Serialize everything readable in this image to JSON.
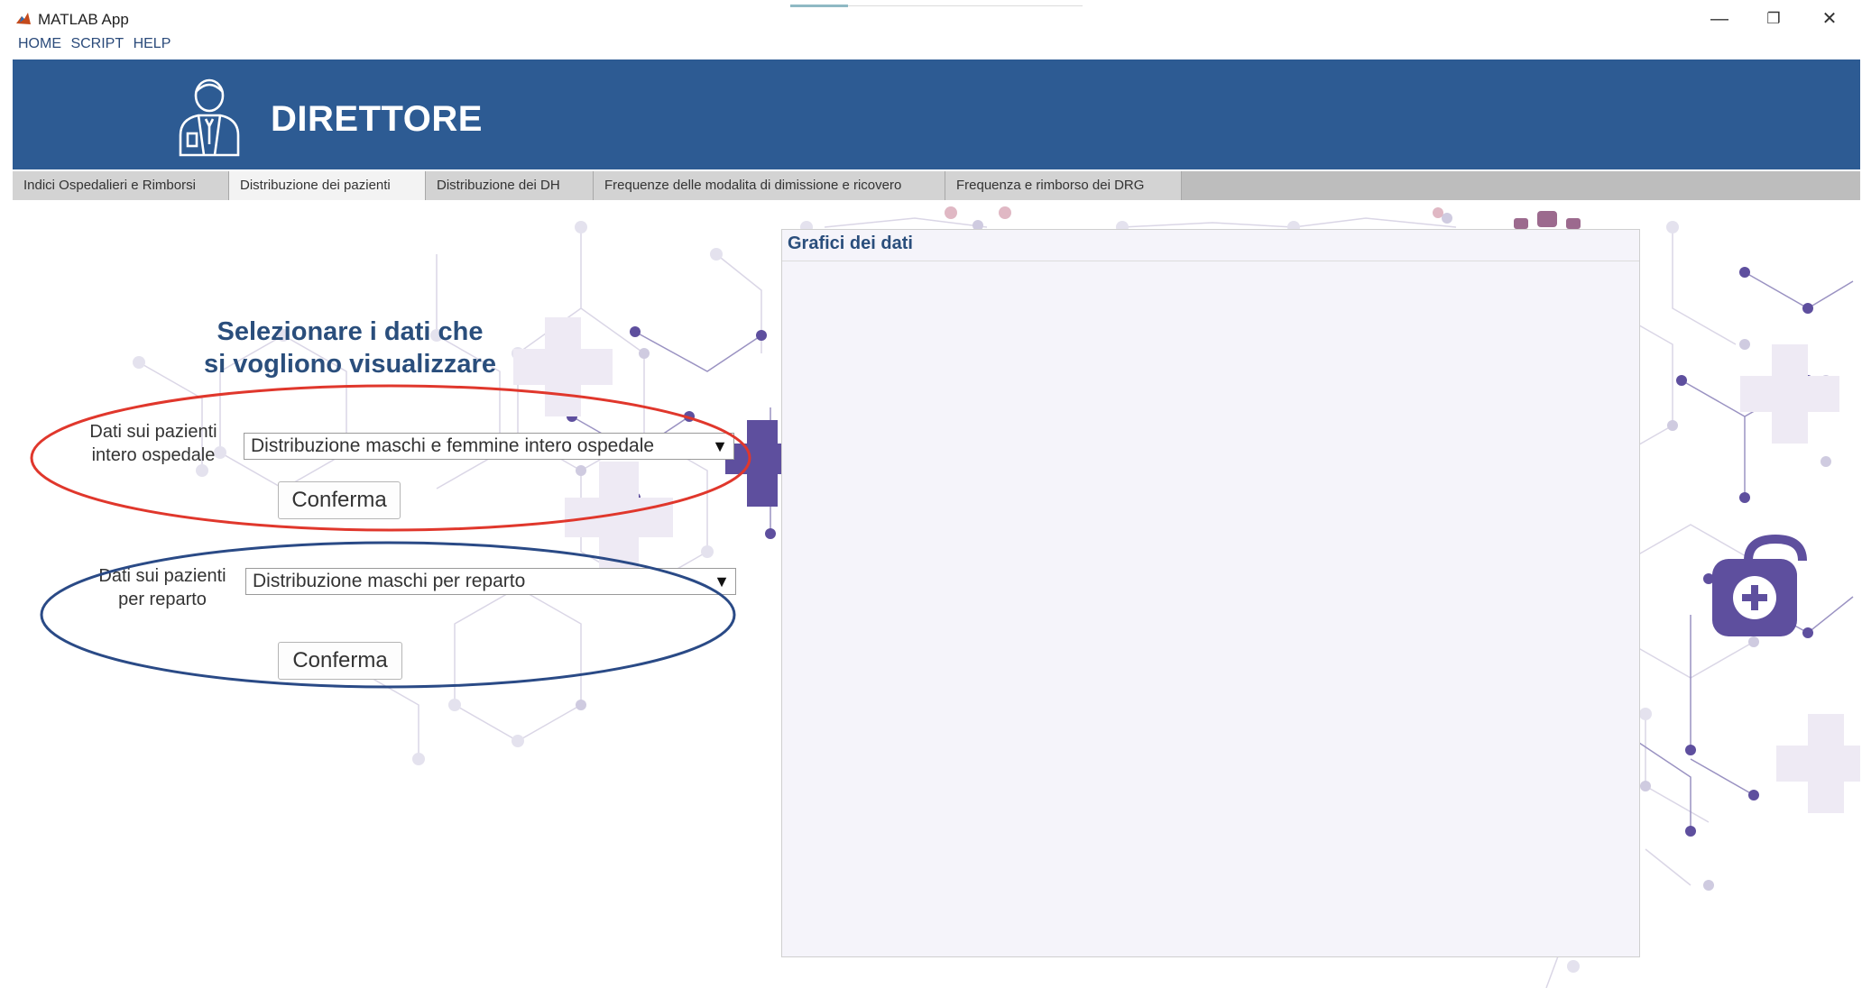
{
  "window": {
    "title": "MATLAB App",
    "controls": {
      "minimize": "—",
      "restore": "❐",
      "close": "✕"
    }
  },
  "menu": {
    "items": [
      "HOME",
      "SCRIPT",
      "HELP"
    ]
  },
  "header": {
    "title": "DIRETTORE",
    "icon": "doctor-icon"
  },
  "tabs": [
    {
      "label": "Indici Ospedalieri e Rimborsi",
      "active": false
    },
    {
      "label": "Distribuzione dei pazienti",
      "active": true
    },
    {
      "label": "Distribuzione dei DH",
      "active": false
    },
    {
      "label": "Frequenze delle modalita di dimissione e ricovero",
      "active": false
    },
    {
      "label": "Frequenza e rimborso dei DRG",
      "active": false
    }
  ],
  "main": {
    "prompt_line1": "Selezionare i dati che",
    "prompt_line2": "si vogliono visualizzare",
    "hospital": {
      "label_line1": "Dati sui pazienti",
      "label_line2": "intero ospedale",
      "selected": "Distribuzione maschi e femmine intero ospedale",
      "confirm": "Conferma"
    },
    "department": {
      "label_line1": "Dati sui pazienti",
      "label_line2": "per reparto",
      "selected": "Distribuzione maschi per reparto",
      "confirm": "Conferma"
    },
    "dropdown_arrow": "▼"
  },
  "panel": {
    "title": "Grafici dei dati"
  },
  "colors": {
    "header_bg": "#2d5b93",
    "title_text": "#2a4e7c",
    "highlight_red": "#e0372c",
    "highlight_blue": "#2a4a86",
    "decor_purple": "#6a5aa8"
  }
}
